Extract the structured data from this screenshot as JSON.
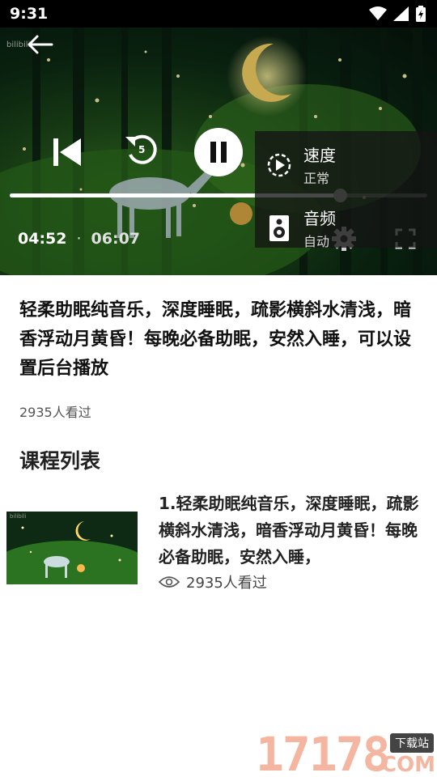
{
  "status_bar": {
    "time": "9:31"
  },
  "player": {
    "watermark": "bilibili",
    "current_time": "04:52",
    "separator": "·",
    "total_time": "06:07",
    "progress": 0.79,
    "buffered": 0.95,
    "replay_seconds": "5",
    "settings": {
      "speed_label": "速度",
      "speed_value": "正常",
      "audio_label": "音频",
      "audio_value": "自动"
    }
  },
  "video": {
    "title": "轻柔助眠纯音乐，深度睡眠，疏影横斜水清浅，暗香浮动月黄昏！每晚必备助眠，安然入睡，可以设置后台播放",
    "views": "2935人看过"
  },
  "course_list": {
    "heading": "课程列表",
    "items": [
      {
        "title": "1.轻柔助眠纯音乐，深度睡眠，疏影横斜水清浅，暗香浮动月黄昏！每晚必备助眠，安然入睡，",
        "views": "2935人看过",
        "thumb_watermark": "bilibili"
      }
    ]
  },
  "site_watermark": {
    "number": "17178",
    "badge": "下载站",
    "suffix": ".COM"
  },
  "colors": {
    "accent": "#ffffff",
    "watermark_pink": "#f4b6a0"
  }
}
